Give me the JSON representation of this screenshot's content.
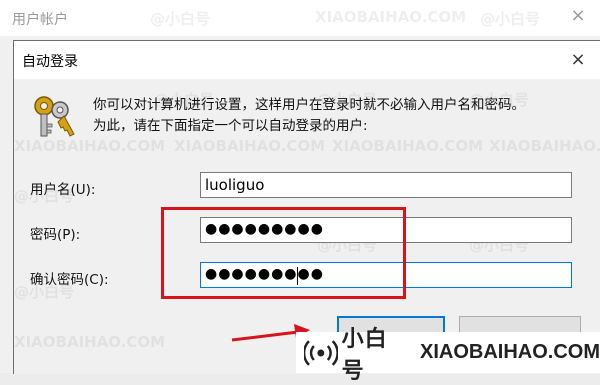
{
  "parent_window": {
    "title": "用户帐户",
    "close_glyph": "×"
  },
  "dialog": {
    "title": "自动登录",
    "close_glyph": "×",
    "description_line1": "你可以对计算机进行设置，这样用户在登录时就不必输入用户名和密码。",
    "description_line2": "为此，请在下面指定一个可以自动登录的用户:",
    "icon": "keys-icon",
    "fields": {
      "username": {
        "label": "用户名(U):",
        "value": "luoliguo"
      },
      "password": {
        "label": "密码(P):",
        "value": "●●●●●●●●●"
      },
      "confirm_password": {
        "label": "确认密码(C):",
        "value": "●●●●●●●●●"
      }
    },
    "buttons": {
      "ok": "",
      "cancel": ""
    }
  },
  "annotation": {
    "color": "#d8141b"
  },
  "watermark": {
    "cn": "@小白号",
    "en": "XIAOBAIHAO.COM"
  },
  "logo": {
    "cn": "小白号",
    "en": "XIAOBAIHAO.COM"
  },
  "colors": {
    "accent": "#0078d7",
    "highlight": "#d8141b"
  }
}
